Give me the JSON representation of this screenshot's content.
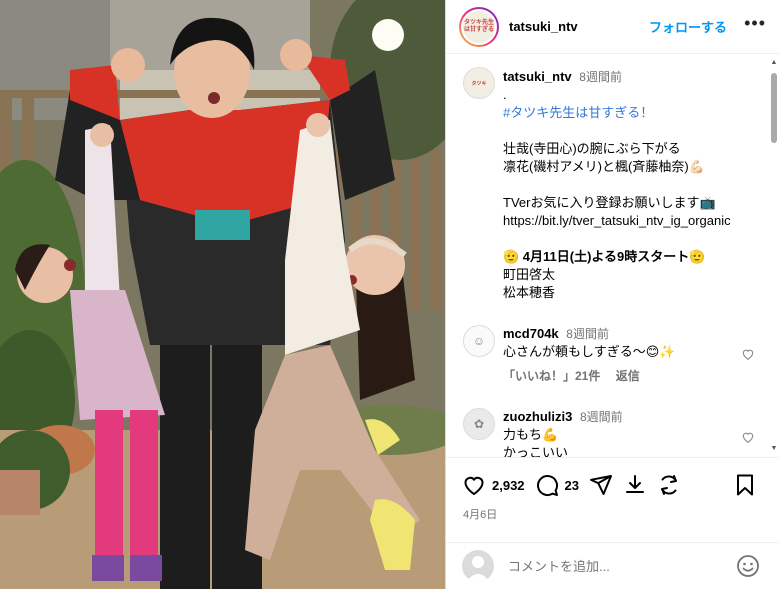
{
  "header": {
    "username": "tatsuki_ntv",
    "follow_label": "フォローする",
    "more_label": "•••",
    "avatar_text": "タツキ先生は甘すぎる"
  },
  "caption": {
    "username": "tatsuki_ntv",
    "time": "8週間前",
    "lines": [
      ".",
      "#タツキ先生は甘すぎる！",
      "",
      "壮哉(寺田心)の腕にぶら下がる",
      "凛花(磯村アメリ)と楓(斉藤柚奈)💪🏻",
      "",
      "TVerお気に入り登録お願いします📺",
      "https://bit.ly/tver_tatsuki_ntv_ig_organic",
      "",
      "🫡 4月11日(土)よる9時スタート🫡",
      "町田啓太",
      "松本穂香"
    ]
  },
  "comments": [
    {
      "username": "mcd704k",
      "time": "8週間前",
      "text": "心さんが頼もしすぎる〜😊✨",
      "likes": "「いいね！」21件",
      "reply": "返信"
    },
    {
      "username": "zuozhulizi3",
      "time": "8週間前",
      "text": "力もち💪",
      "text2": "かっこいい"
    }
  ],
  "actions": {
    "likes_count": "2,932",
    "comments_count": "23",
    "date": "4月6日"
  },
  "add_comment": {
    "placeholder": "コメントを追加..."
  },
  "icons": {
    "like": "heart-icon",
    "comment": "comment-icon",
    "share": "send-icon",
    "download": "download-icon",
    "repost": "repost-icon",
    "save": "bookmark-icon",
    "emoji": "emoji-icon"
  },
  "colors": {
    "link": "#0095f6",
    "hashtag": "#3478d8",
    "muted": "#737373"
  }
}
